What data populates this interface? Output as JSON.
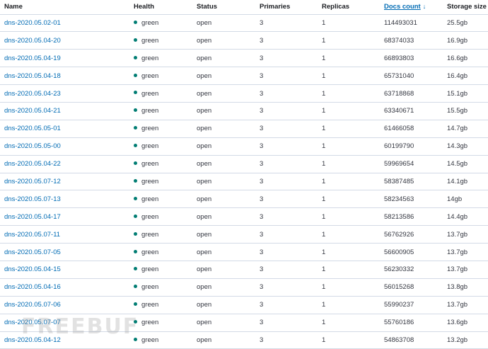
{
  "columns": {
    "name": "Name",
    "health": "Health",
    "status": "Status",
    "primaries": "Primaries",
    "replicas": "Replicas",
    "docs_count": "Docs count",
    "storage_size": "Storage size"
  },
  "sort": {
    "column": "docs_count",
    "direction": "descending",
    "icon": "arrow-down-icon"
  },
  "colors": {
    "link": "#006bb4",
    "health_green": "#017d73",
    "border": "#d3dae6"
  },
  "rows": [
    {
      "name": "dns-2020.05.02-01",
      "health": "green",
      "status": "open",
      "primaries": "3",
      "replicas": "1",
      "docs": "114493031",
      "size": "25.5gb"
    },
    {
      "name": "dns-2020.05.04-20",
      "health": "green",
      "status": "open",
      "primaries": "3",
      "replicas": "1",
      "docs": "68374033",
      "size": "16.9gb"
    },
    {
      "name": "dns-2020.05.04-19",
      "health": "green",
      "status": "open",
      "primaries": "3",
      "replicas": "1",
      "docs": "66893803",
      "size": "16.6gb"
    },
    {
      "name": "dns-2020.05.04-18",
      "health": "green",
      "status": "open",
      "primaries": "3",
      "replicas": "1",
      "docs": "65731040",
      "size": "16.4gb"
    },
    {
      "name": "dns-2020.05.04-23",
      "health": "green",
      "status": "open",
      "primaries": "3",
      "replicas": "1",
      "docs": "63718868",
      "size": "15.1gb"
    },
    {
      "name": "dns-2020.05.04-21",
      "health": "green",
      "status": "open",
      "primaries": "3",
      "replicas": "1",
      "docs": "63340671",
      "size": "15.5gb"
    },
    {
      "name": "dns-2020.05.05-01",
      "health": "green",
      "status": "open",
      "primaries": "3",
      "replicas": "1",
      "docs": "61466058",
      "size": "14.7gb"
    },
    {
      "name": "dns-2020.05.05-00",
      "health": "green",
      "status": "open",
      "primaries": "3",
      "replicas": "1",
      "docs": "60199790",
      "size": "14.3gb"
    },
    {
      "name": "dns-2020.05.04-22",
      "health": "green",
      "status": "open",
      "primaries": "3",
      "replicas": "1",
      "docs": "59969654",
      "size": "14.5gb"
    },
    {
      "name": "dns-2020.05.07-12",
      "health": "green",
      "status": "open",
      "primaries": "3",
      "replicas": "1",
      "docs": "58387485",
      "size": "14.1gb"
    },
    {
      "name": "dns-2020.05.07-13",
      "health": "green",
      "status": "open",
      "primaries": "3",
      "replicas": "1",
      "docs": "58234563",
      "size": "14gb"
    },
    {
      "name": "dns-2020.05.04-17",
      "health": "green",
      "status": "open",
      "primaries": "3",
      "replicas": "1",
      "docs": "58213586",
      "size": "14.4gb"
    },
    {
      "name": "dns-2020.05.07-11",
      "health": "green",
      "status": "open",
      "primaries": "3",
      "replicas": "1",
      "docs": "56762926",
      "size": "13.7gb"
    },
    {
      "name": "dns-2020.05.07-05",
      "health": "green",
      "status": "open",
      "primaries": "3",
      "replicas": "1",
      "docs": "56600905",
      "size": "13.7gb"
    },
    {
      "name": "dns-2020.05.04-15",
      "health": "green",
      "status": "open",
      "primaries": "3",
      "replicas": "1",
      "docs": "56230332",
      "size": "13.7gb"
    },
    {
      "name": "dns-2020.05.04-16",
      "health": "green",
      "status": "open",
      "primaries": "3",
      "replicas": "1",
      "docs": "56015268",
      "size": "13.8gb"
    },
    {
      "name": "dns-2020.05.07-06",
      "health": "green",
      "status": "open",
      "primaries": "3",
      "replicas": "1",
      "docs": "55990237",
      "size": "13.7gb"
    },
    {
      "name": "dns-2020.05.07-07",
      "health": "green",
      "status": "open",
      "primaries": "3",
      "replicas": "1",
      "docs": "55760186",
      "size": "13.6gb"
    },
    {
      "name": "dns-2020.05.04-12",
      "health": "green",
      "status": "open",
      "primaries": "3",
      "replicas": "1",
      "docs": "54863708",
      "size": "13.2gb"
    }
  ],
  "watermark": "FREEBUF"
}
